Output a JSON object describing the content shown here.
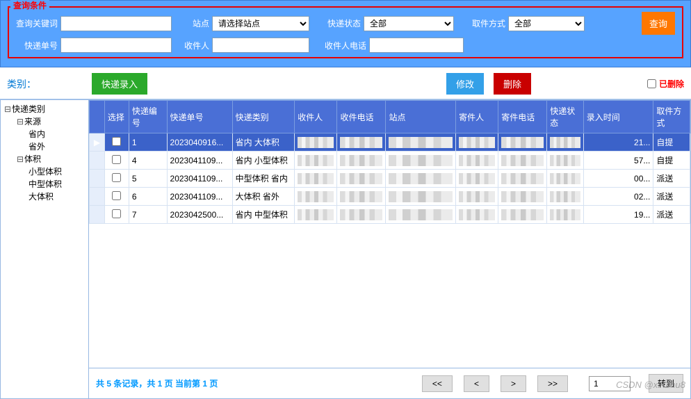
{
  "query": {
    "panel_title": "查询条件",
    "keyword_label": "查询关键词",
    "keyword_value": "",
    "station_label": "站点",
    "station_selected": "请选择站点",
    "status_label": "快递状态",
    "status_selected": "全部",
    "pickup_label": "取件方式",
    "pickup_selected": "全部",
    "tracking_label": "快递单号",
    "tracking_value": "",
    "recipient_label": "收件人",
    "recipient_value": "",
    "phone_label": "收件人电话",
    "phone_value": "",
    "search_btn": "查询"
  },
  "toolbar": {
    "category_label": "类别：",
    "entry_btn": "快递录入",
    "edit_btn": "修改",
    "delete_btn": "删除",
    "deleted_label": "已删除"
  },
  "tree": {
    "root": "快递类别",
    "source": "来源",
    "domestic": "省内",
    "foreign": "省外",
    "volume": "体积",
    "small": "小型体积",
    "medium": "中型体积",
    "large": "大体积"
  },
  "grid": {
    "headers": {
      "select": "选择",
      "id": "快递编号",
      "tracking": "快递单号",
      "category": "快递类别",
      "recipient": "收件人",
      "rphone": "收件电话",
      "station": "站点",
      "sender": "寄件人",
      "sphone": "寄件电话",
      "status": "快递状态",
      "entry_time": "录入时间",
      "pickup": "取件方式"
    },
    "rows": [
      {
        "id": "1",
        "tracking": "2023040916...",
        "category": "省内 大体积",
        "entry_suffix": "21...",
        "pickup": "自提",
        "selected": true
      },
      {
        "id": "4",
        "tracking": "2023041109...",
        "category": "省内 小型体积",
        "entry_suffix": "57...",
        "pickup": "自提",
        "selected": false
      },
      {
        "id": "5",
        "tracking": "2023041109...",
        "category": "中型体积 省内",
        "entry_suffix": "00...",
        "pickup": "派送",
        "selected": false
      },
      {
        "id": "6",
        "tracking": "2023041109...",
        "category": "大体积 省外",
        "entry_suffix": "02...",
        "pickup": "派送",
        "selected": false
      },
      {
        "id": "7",
        "tracking": "2023042500...",
        "category": "省内 中型体积",
        "entry_suffix": "19...",
        "pickup": "派送",
        "selected": false
      }
    ]
  },
  "pager": {
    "info": "共 5 条记录，共 1 页  当前第 1 页",
    "first": "<<",
    "prev": "<",
    "next": ">",
    "last": ">>",
    "page_value": "1",
    "goto_btn": "转到"
  },
  "watermark": "CSDN @xinZhu8"
}
